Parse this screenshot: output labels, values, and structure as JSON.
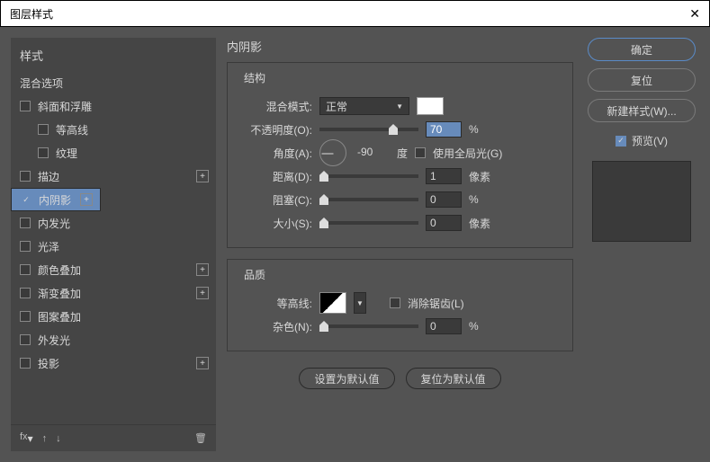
{
  "window": {
    "title": "图层样式",
    "close": "✕"
  },
  "styles": {
    "header": "样式",
    "blend_options": "混合选项",
    "items": [
      {
        "label": "斜面和浮雕",
        "checked": false,
        "plus": false,
        "sub": false
      },
      {
        "label": "等高线",
        "checked": false,
        "plus": false,
        "sub": true
      },
      {
        "label": "纹理",
        "checked": false,
        "plus": false,
        "sub": true
      },
      {
        "label": "描边",
        "checked": false,
        "plus": true,
        "sub": false
      },
      {
        "label": "内阴影",
        "checked": true,
        "plus": true,
        "sub": false,
        "selected": true
      },
      {
        "label": "内发光",
        "checked": false,
        "plus": false,
        "sub": false
      },
      {
        "label": "光泽",
        "checked": false,
        "plus": false,
        "sub": false
      },
      {
        "label": "颜色叠加",
        "checked": false,
        "plus": true,
        "sub": false
      },
      {
        "label": "渐变叠加",
        "checked": false,
        "plus": true,
        "sub": false
      },
      {
        "label": "图案叠加",
        "checked": false,
        "plus": false,
        "sub": false
      },
      {
        "label": "外发光",
        "checked": false,
        "plus": false,
        "sub": false
      },
      {
        "label": "投影",
        "checked": false,
        "plus": true,
        "sub": false
      }
    ],
    "fx": "fx"
  },
  "panel": {
    "title": "内阴影",
    "g1": {
      "title": "结构",
      "blend_mode_label": "混合模式:",
      "blend_mode_value": "正常",
      "opacity_label": "不透明度(O):",
      "opacity_value": "70",
      "opacity_unit": "%",
      "angle_label": "角度(A):",
      "angle_value": "-90",
      "angle_unit": "度",
      "global_label": "使用全局光(G)",
      "distance_label": "距离(D):",
      "distance_value": "1",
      "distance_unit": "像素",
      "choke_label": "阻塞(C):",
      "choke_value": "0",
      "choke_unit": "%",
      "size_label": "大小(S):",
      "size_value": "0",
      "size_unit": "像素"
    },
    "g2": {
      "title": "品质",
      "contour_label": "等高线:",
      "aa_label": "消除锯齿(L)",
      "noise_label": "杂色(N):",
      "noise_value": "0",
      "noise_unit": "%"
    },
    "make_default": "设置为默认值",
    "reset_default": "复位为默认值"
  },
  "right": {
    "ok": "确定",
    "reset": "复位",
    "new_style": "新建样式(W)...",
    "preview": "预览(V)"
  }
}
